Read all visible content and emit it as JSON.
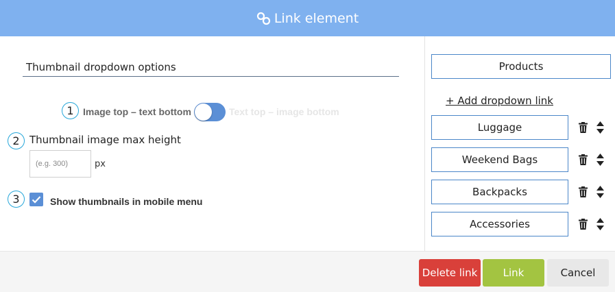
{
  "header": {
    "title": "Link element",
    "icon": "link-icon"
  },
  "left": {
    "section_title": "Thumbnail dropdown options",
    "steps": [
      "1",
      "2",
      "3"
    ],
    "layout_option_left": "Image top – text bottom",
    "layout_option_right": "Text top – image bottom",
    "max_height_label": "Thumbnail image max height",
    "max_height_placeholder": "(e.g. 300)",
    "max_height_unit": "px",
    "mobile_thumbnails_label": "Show thumbnails in mobile menu"
  },
  "right": {
    "parent_link": "Products",
    "add_dropdown_link": "+ Add dropdown link",
    "dropdown_links": [
      "Luggage",
      "Weekend Bags",
      "Backpacks",
      "Accessories"
    ]
  },
  "footer": {
    "delete_label": "Delete link",
    "link_label": "Link",
    "cancel_label": "Cancel"
  },
  "colors": {
    "header": "#7fb1ef",
    "accent": "#5b8fd6",
    "delete": "#d9403a",
    "link": "#a3c441",
    "step_circle": "#25a6d9"
  }
}
